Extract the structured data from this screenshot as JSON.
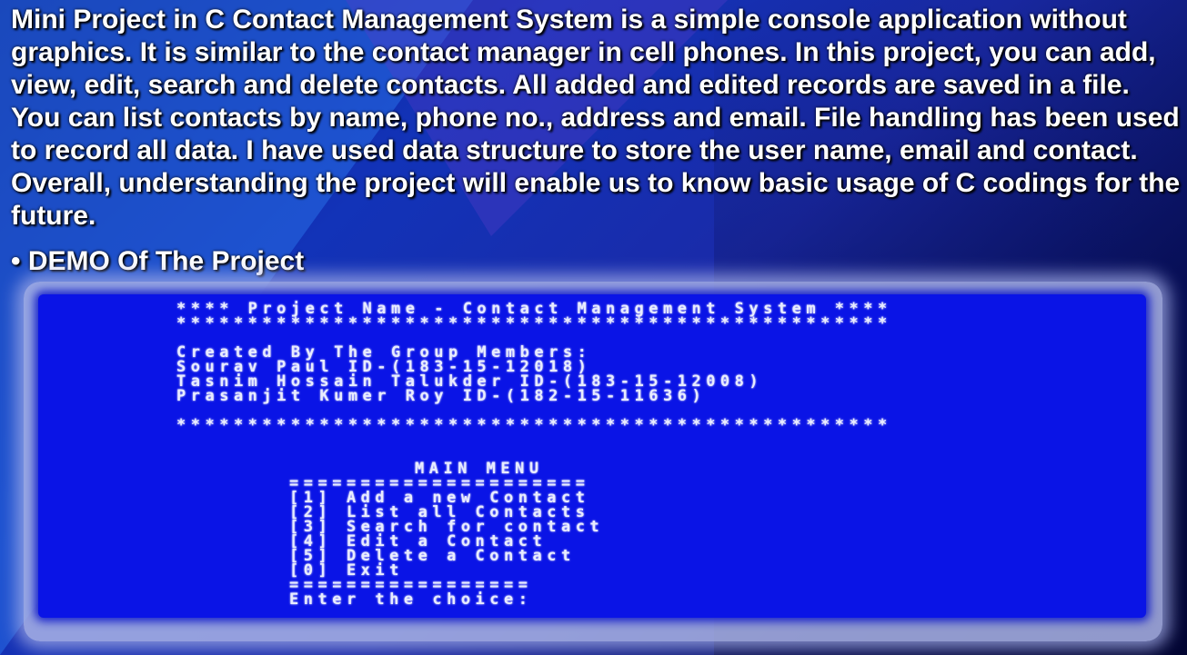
{
  "slide": {
    "paragraph": "Mini Project in C Contact Management System is a simple console application without graphics. It is similar to the contact manager in cell phones. In this project, you can add, view, edit, search and delete contacts. All added and edited records are saved in a file. You can list contacts by name, phone no., address and email. File handling has been used to record all data. I have used data structure to store the user name, email and contact. Overall, understanding the project will enable us to know basic usage of C codings for the future.",
    "bullet": "• DEMO Of The Project"
  },
  "console": {
    "header_title": "**** Project Name - Contact Management System ****",
    "header_rule": "**************************************************",
    "created_by": "Created By The Group Members:",
    "members": [
      "Sourav Paul ID-(183-15-12018)",
      "Tasnim Hossain Talukder ID-(183-15-12008)",
      "Prasanjit Kumer Roy ID-(182-15-11636)"
    ],
    "footer_rule": "**************************************************",
    "menu_title": "MAIN MENU",
    "menu_rule_top": "=====================",
    "menu_items": [
      "[1] Add a new Contact",
      "[2] List all Contacts",
      "[3] Search for contact",
      "[4] Edit a Contact",
      "[5] Delete a Contact",
      "[0] Exit"
    ],
    "menu_rule_bottom": "=================",
    "prompt": "Enter the choice:"
  },
  "colors": {
    "console_background": "#0a14e6",
    "console_text": "#e8ecff",
    "slide_text": "#ffffff"
  }
}
